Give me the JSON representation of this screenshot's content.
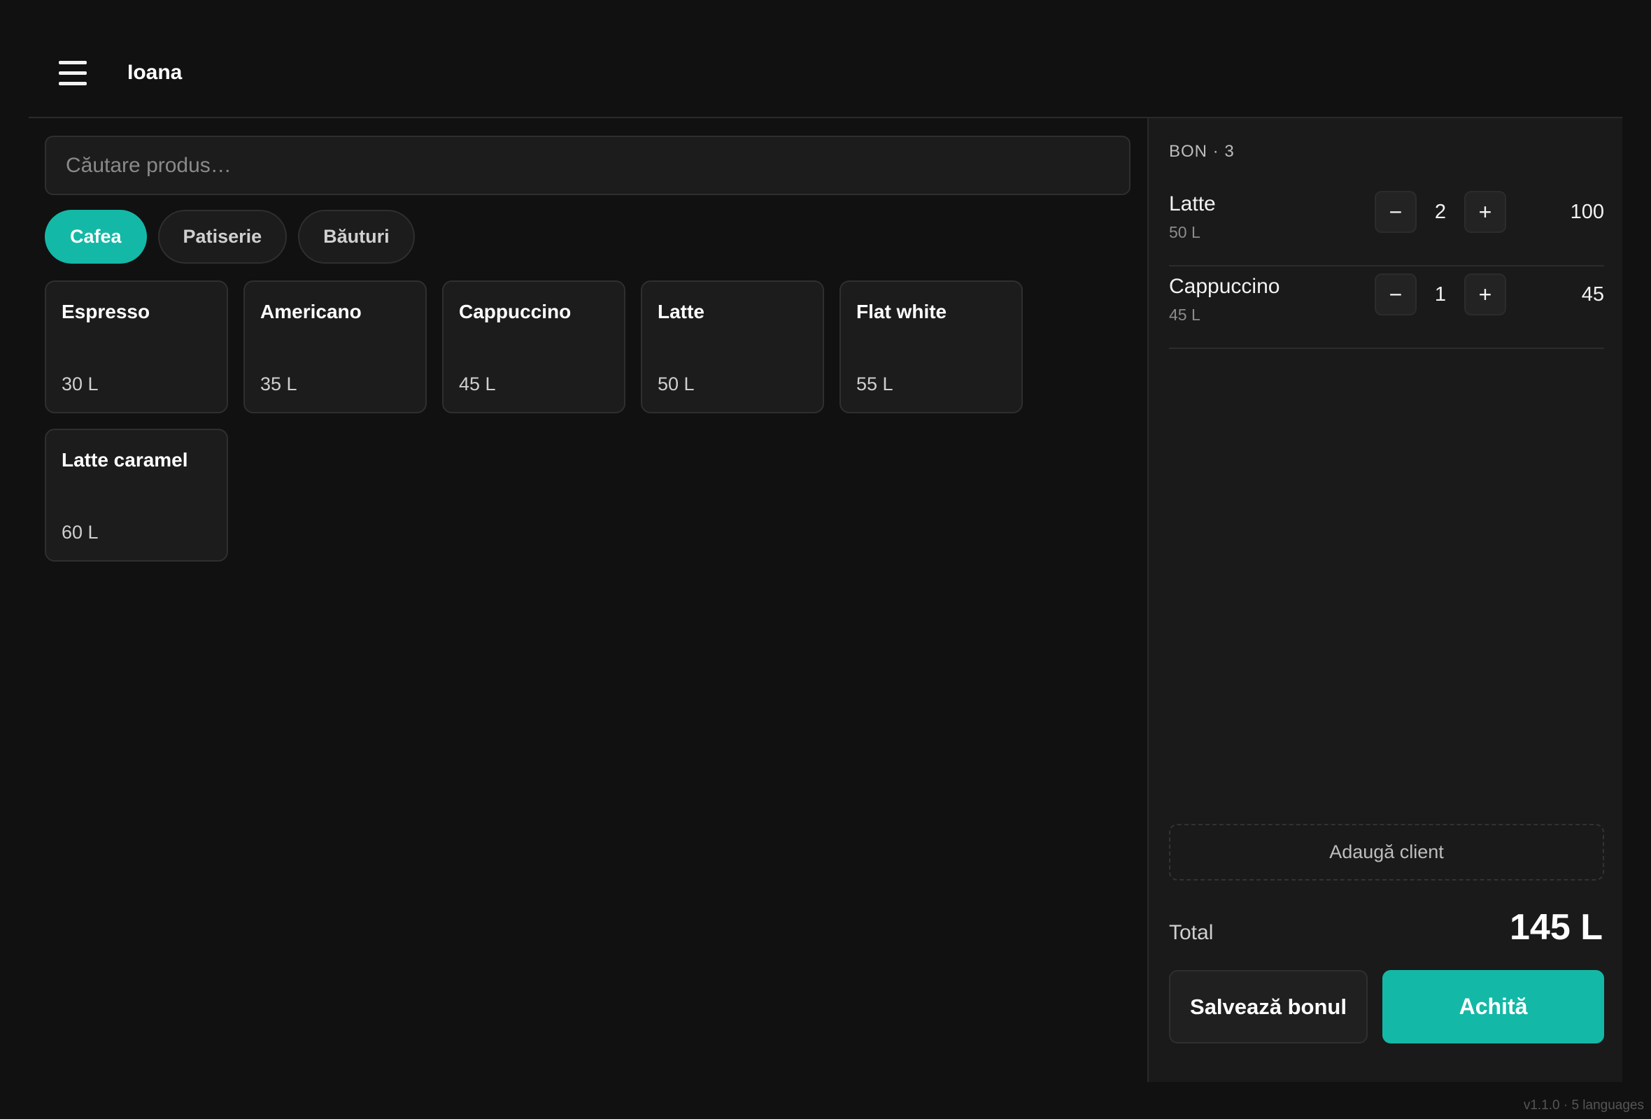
{
  "header": {
    "menu_icon": "hamburger-menu-icon",
    "user_name": "Ioana"
  },
  "search": {
    "placeholder": "Căutare produs…",
    "value": ""
  },
  "categories": [
    {
      "label": "Cafea",
      "active": true
    },
    {
      "label": "Patiserie",
      "active": false
    },
    {
      "label": "Băuturi",
      "active": false
    }
  ],
  "products": [
    {
      "name": "Espresso",
      "price": "30 L"
    },
    {
      "name": "Americano",
      "price": "35 L"
    },
    {
      "name": "Cappuccino",
      "price": "45 L"
    },
    {
      "name": "Latte",
      "price": "50 L"
    },
    {
      "name": "Flat white",
      "price": "55 L"
    },
    {
      "name": "Latte caramel",
      "price": "60 L"
    }
  ],
  "cart": {
    "title": "BON · 3",
    "lines": [
      {
        "name": "Latte",
        "unit_price": "50 L",
        "minus": "−",
        "qty": "2",
        "plus": "+",
        "total": "100"
      },
      {
        "name": "Cappuccino",
        "unit_price": "45 L",
        "minus": "−",
        "qty": "1",
        "plus": "+",
        "total": "45"
      }
    ],
    "add_client_label": "Adaugă client",
    "total_label": "Total",
    "total_value": "145 L",
    "save_label": "Salvează bonul",
    "pay_label": "Achită"
  },
  "footer": {
    "version": "v1.1.0 · 5 languages"
  },
  "colors": {
    "accent": "#14b8a6",
    "background": "#111111",
    "panel": "#1a1a1a"
  }
}
